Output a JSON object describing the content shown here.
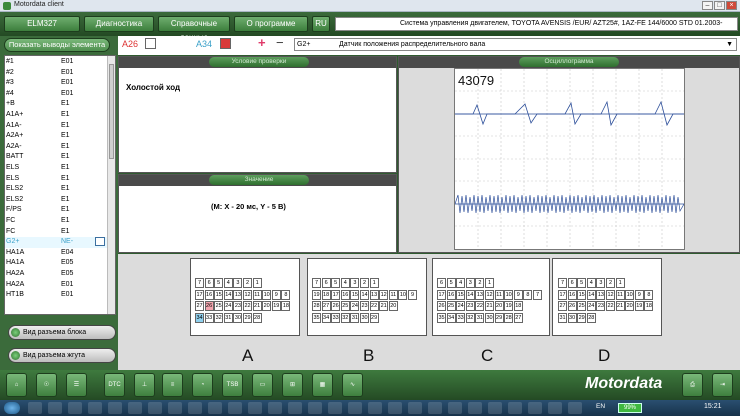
{
  "window": {
    "title": "Motordata client"
  },
  "menu": {
    "elm": "ELM327",
    "diag": "Диагностика",
    "ref": "Справочные данные",
    "about": "О программе",
    "lang": "RU"
  },
  "sysinfo": "Система управления двигателем, TOYOTA  AVENSIS /EUR/  AZT25#,   1AZ-FE 144/6000  STD  01.2003-",
  "left": {
    "show_pins": "Показать выводы элемента",
    "pins": [
      {
        "pin": "#1",
        "conn": "E01"
      },
      {
        "pin": "#2",
        "conn": "E01"
      },
      {
        "pin": "#3",
        "conn": "E01"
      },
      {
        "pin": "#4",
        "conn": "E01"
      },
      {
        "pin": "+B",
        "conn": "E1"
      },
      {
        "pin": "A1A+",
        "conn": "E1"
      },
      {
        "pin": "A1A-",
        "conn": "E1"
      },
      {
        "pin": "A2A+",
        "conn": "E1"
      },
      {
        "pin": "A2A-",
        "conn": "E1"
      },
      {
        "pin": "BATT",
        "conn": "E1"
      },
      {
        "pin": "ELS",
        "conn": "E1"
      },
      {
        "pin": "ELS",
        "conn": "E1"
      },
      {
        "pin": "ELS2",
        "conn": "E1"
      },
      {
        "pin": "ELS2",
        "conn": "E1"
      },
      {
        "pin": "F/PS",
        "conn": "E1"
      },
      {
        "pin": "FC",
        "conn": "E1"
      },
      {
        "pin": "FC",
        "conn": "E1"
      },
      {
        "pin": "G2+",
        "conn": "NE-"
      },
      {
        "pin": "HA1A",
        "conn": "E04"
      },
      {
        "pin": "HA1A",
        "conn": "E05"
      },
      {
        "pin": "HA2A",
        "conn": "E05"
      },
      {
        "pin": "HA2A",
        "conn": "E01"
      },
      {
        "pin": "HT1B",
        "conn": "E01"
      }
    ],
    "view_block": "Вид разъема блока",
    "view_harness": "Вид разъема жгута"
  },
  "pinbar": {
    "pin_a": "A26",
    "pin_b": "A34",
    "plus": "+",
    "minus": "−",
    "sig_code": "G2+",
    "sig_name": "Датчик положения распределительного вала"
  },
  "panels": {
    "cond_title": "Условие проверки",
    "cond_text": "Холостой ход",
    "value_title": "Значение",
    "value_text": "(M: X - 20 мс, Y - 5 В)",
    "osc_title": "Осциллограмма",
    "osc_number": "43079"
  },
  "connectors": {
    "labels": [
      "A",
      "B",
      "C",
      "D"
    ]
  },
  "toolbar": {
    "tsb": "TSB",
    "dtc": "DTC",
    "brand": "Motordata"
  },
  "taskbar": {
    "battery": "99%",
    "clock": "15:21",
    "lang": "EN"
  }
}
